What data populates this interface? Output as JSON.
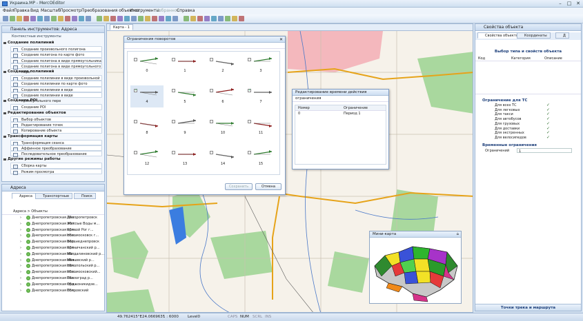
{
  "window": {
    "title": "Украина.MP - MercOEditor",
    "min": "–",
    "max": "□",
    "close": "✕"
  },
  "menu": [
    "Файл",
    "Правка",
    "Вид",
    "Масштаб",
    "Просмотр",
    "Преобразования объектов",
    "Инструменты",
    "Избранное",
    "Справка"
  ],
  "left_panel": {
    "title": "Панель инструментов: Адреса",
    "subtitle": "Контекстные инструменты",
    "sections": [
      {
        "title": "Создание полилиний",
        "items": [
          "Создание произвольного полигона",
          "Создание полигона по карте фото",
          "Создание полигона в виде прямоугольника",
          "Создание полигона в виде прямоугольного пере"
        ]
      },
      {
        "title": "Создание полилиний",
        "items": [
          "Создание полилинии в виде произвольной линии",
          "Создание полилинии по карте фото",
          "Создание полилинии в виде прямоугольника",
          "Создание полилинии в виде прямоугольного пере"
        ]
      },
      {
        "title": "Создание POI",
        "items": [
          "Создание POI"
        ]
      },
      {
        "title": "Редактирование объектов",
        "items": [
          "Выбор объектов",
          "Редактирование точек",
          "Копирование объекта"
        ]
      },
      {
        "title": "Трансформация карты",
        "items": [
          "Трансформация сеанса",
          "Аффинное преобразование",
          "Последовательное преобразование"
        ]
      },
      {
        "title": "Другие режимы работы",
        "items": [
          "Сборка карты",
          "Режим просмотра"
        ]
      }
    ]
  },
  "addr_panel": {
    "title": "Адреса",
    "tabs": [
      "Адреса",
      "Транспортные",
      "Поиск"
    ],
    "list_header": "Адреса > Объекты",
    "rows": [
      [
        "Днепропетровская обл...",
        "Днепропетровск"
      ],
      [
        "Днепропетровская обл...",
        "Желтые Воды м..."
      ],
      [
        "Днепропетровская обл...",
        "Кривой Рог г..."
      ],
      [
        "Днепропетровская обл...",
        "Новомосковск г..."
      ],
      [
        "Днепропетровская обл...",
        "Верхнеднепровск"
      ],
      [
        "Днепропетровская обл...",
        "Криничанский р..."
      ],
      [
        "Днепропетровская обл...",
        "Магдалиновский р..."
      ],
      [
        "Днепропетровская обл...",
        "Межевский р..."
      ],
      [
        "Днепропетровская обл...",
        "Никопольский р..."
      ],
      [
        "Днепропетровская обл...",
        "Новомосковский..."
      ],
      [
        "Днепропетровская обл...",
        "Павлоград р..."
      ],
      [
        "Днепропетровская обл...",
        "Орджоникидзе..."
      ],
      [
        "Днепропетровская обл...",
        "Покровский"
      ]
    ]
  },
  "doc_tab": "Карта - 1",
  "restrictions_dialog": {
    "title": "Ограничения поворотов",
    "labels": [
      "0",
      "1",
      "2",
      "3",
      "4",
      "5",
      "6",
      "7",
      "8",
      "9",
      "10",
      "11",
      "12",
      "13",
      "14",
      "15"
    ],
    "checked": [
      false,
      false,
      false,
      false,
      true,
      false,
      false,
      true,
      false,
      false,
      false,
      false,
      false,
      false,
      false,
      false
    ],
    "btn_save": "Сохранить",
    "btn_cancel": "Отмена"
  },
  "edit_dialog": {
    "title": "Редактирование времени действия ограничения",
    "col1": "Номер",
    "col2": "Ограничение",
    "row_num": "0",
    "row_val": "Период 1"
  },
  "minimap": {
    "title": "Мини-карта",
    "pin": "⌂"
  },
  "right_panel": {
    "title": "Свойства объекта",
    "tabs": [
      "Свойства объектов",
      "Координаты",
      "Д"
    ],
    "section_title": "Выбор типа и свойств объекта",
    "cols": [
      "Код",
      "Категория",
      "Описание"
    ],
    "group1": "Ограничение для ТС",
    "restr_rows": [
      "Для всех ТС",
      "Для легковых",
      "Для такси",
      "Для автобусов",
      "Для грузовых",
      "Для доставки",
      "Для экстренных",
      "Для велосипедов"
    ],
    "group2": "Временные ограничения",
    "time_label": "Ограничений",
    "time_value": "1",
    "bottom_btn": "Точки трека и маршрута"
  },
  "status": {
    "coords": "49.762415°E24.066963°",
    "scale": "1 : 6000",
    "level": "Level0",
    "caps": "CAPS",
    "num": "NUM",
    "scrl": "SCRL",
    "ins": "INS"
  },
  "colors": {
    "accent": "#3a7bd5",
    "panel": "#f3f7fc",
    "chrome": "#d6e3f2"
  }
}
